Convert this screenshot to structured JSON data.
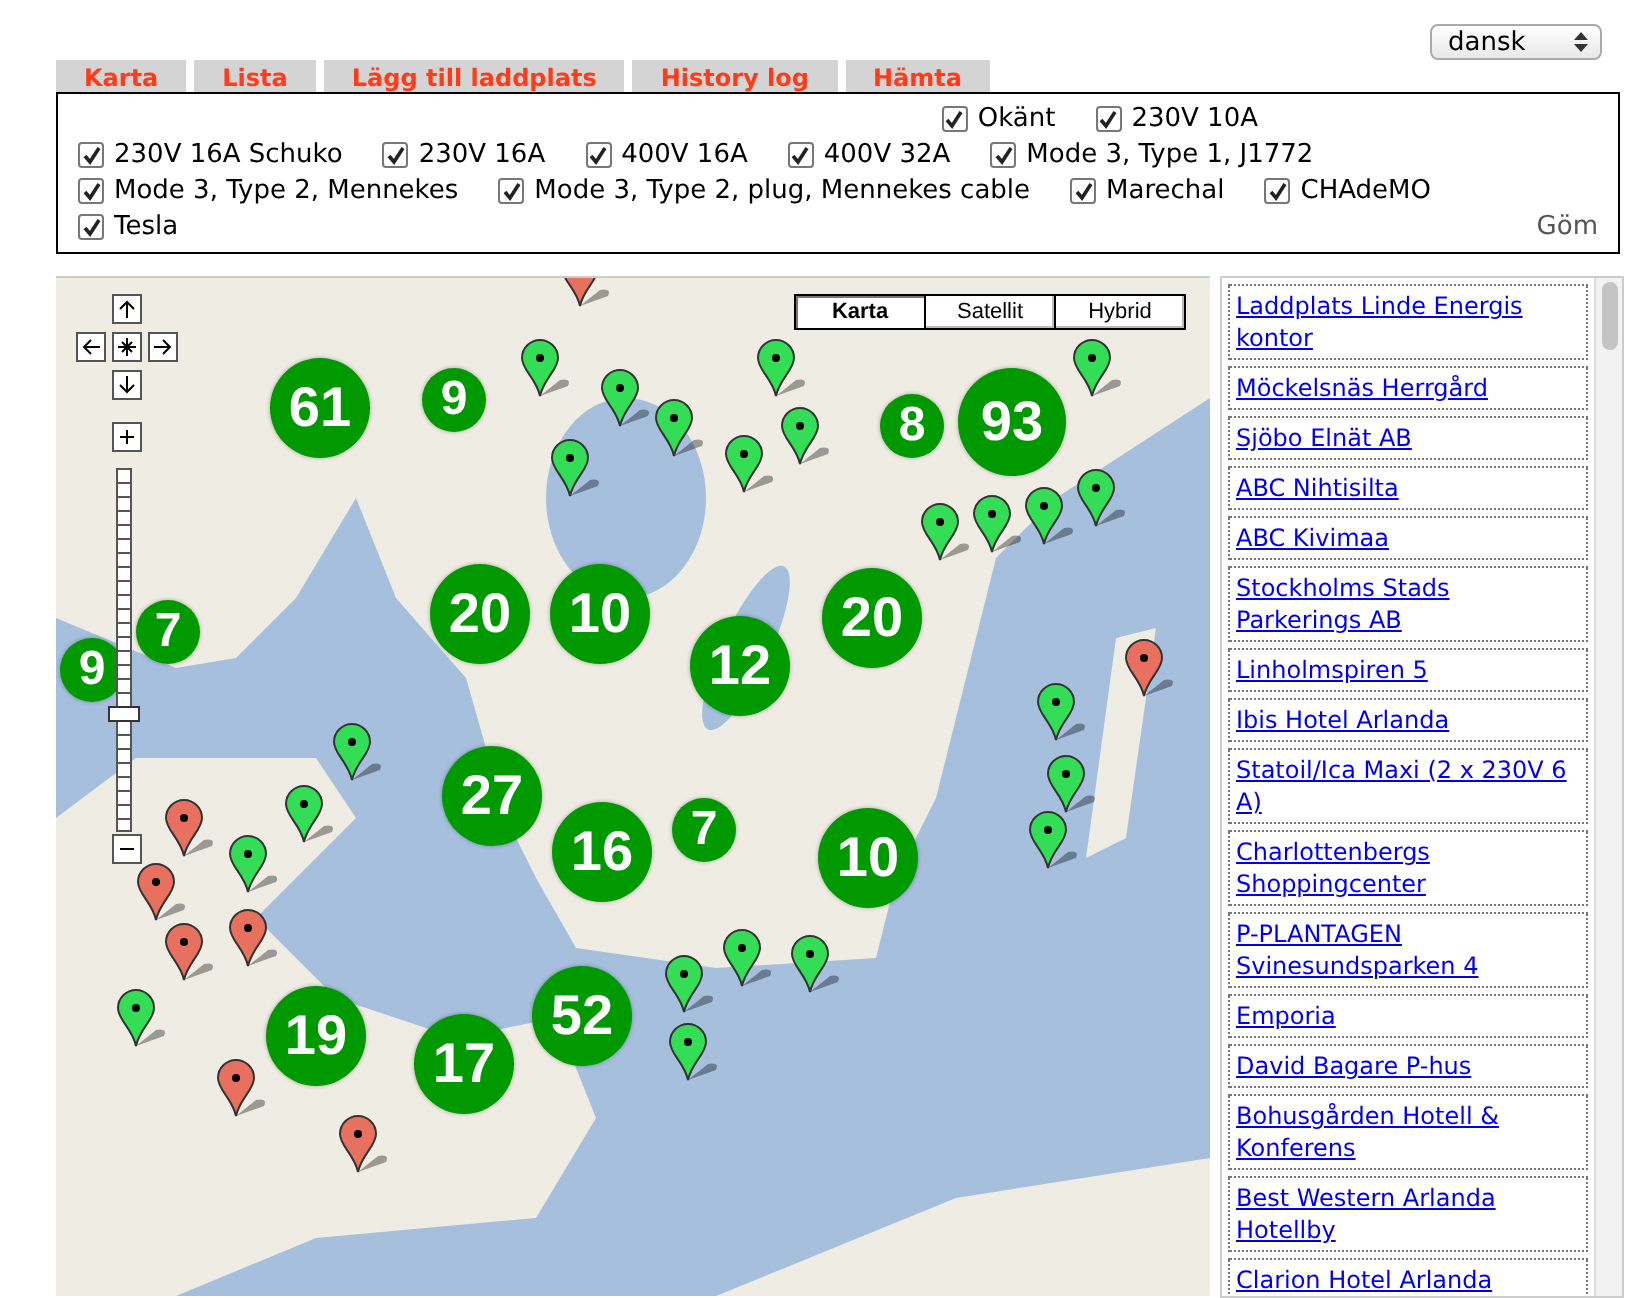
{
  "language_select": {
    "value": "dansk"
  },
  "tabs": [
    {
      "label": "Karta"
    },
    {
      "label": "Lista"
    },
    {
      "label": "Lägg till laddplats"
    },
    {
      "label": "History log"
    },
    {
      "label": "Hämta"
    }
  ],
  "filters": [
    {
      "label": "Okänt",
      "checked": true
    },
    {
      "label": "230V 10A",
      "checked": true
    },
    {
      "label": "230V 16A Schuko",
      "checked": true
    },
    {
      "label": "230V 16A",
      "checked": true
    },
    {
      "label": "400V 16A",
      "checked": true
    },
    {
      "label": "400V 32A",
      "checked": true
    },
    {
      "label": "Mode 3, Type 1, J1772",
      "checked": true
    },
    {
      "label": "Mode 3, Type 2, Mennekes",
      "checked": true
    },
    {
      "label": "Mode 3, Type 2, plug, Mennekes cable",
      "checked": true
    },
    {
      "label": "Marechal",
      "checked": true
    },
    {
      "label": "CHAdeMO",
      "checked": true
    },
    {
      "label": "Tesla",
      "checked": true
    }
  ],
  "hide_link": "Göm",
  "map": {
    "map_types": [
      {
        "label": "Karta",
        "selected": true
      },
      {
        "label": "Satellit",
        "selected": false
      },
      {
        "label": "Hybrid",
        "selected": false
      }
    ],
    "zoom": {
      "level": 0.32
    },
    "clusters": [
      "61",
      "9",
      "8",
      "93",
      "9",
      "7",
      "20",
      "10",
      "12",
      "20",
      "27",
      "16",
      "7",
      "10",
      "19",
      "17",
      "52"
    ],
    "markers": [
      {
        "color": "#e8705f"
      },
      {
        "color": "#33dd55"
      },
      {
        "color": "#33dd55"
      },
      {
        "color": "#33dd55"
      },
      {
        "color": "#33dd55"
      },
      {
        "color": "#33dd55"
      },
      {
        "color": "#33dd55"
      },
      {
        "color": "#33dd55"
      },
      {
        "color": "#33dd55"
      },
      {
        "color": "#33dd55"
      },
      {
        "color": "#33dd55"
      },
      {
        "color": "#33dd55"
      },
      {
        "color": "#33dd55"
      },
      {
        "color": "#e8705f"
      },
      {
        "color": "#33dd55"
      },
      {
        "color": "#33dd55"
      },
      {
        "color": "#33dd55"
      },
      {
        "color": "#33dd55"
      },
      {
        "color": "#e8705f"
      },
      {
        "color": "#33dd55"
      },
      {
        "color": "#33dd55"
      },
      {
        "color": "#e8705f"
      },
      {
        "color": "#e8705f"
      },
      {
        "color": "#e8705f"
      },
      {
        "color": "#33dd55"
      },
      {
        "color": "#33dd55"
      },
      {
        "color": "#33dd55"
      },
      {
        "color": "#33dd55"
      },
      {
        "color": "#33dd55"
      },
      {
        "color": "#e8705f"
      },
      {
        "color": "#e8705f"
      }
    ]
  },
  "locations": [
    "Laddplats Linde Energis kontor",
    "Möckelsnäs Herrgård",
    "Sjöbo Elnät AB",
    "ABC Nihtisilta",
    "ABC Kivimaa",
    "Stockholms Stads Parkerings AB",
    "Linholmspiren 5",
    "Ibis Hotel Arlanda",
    "Statoil/Ica Maxi (2 x 230V 6 A)",
    "Charlottenbergs Shoppingcenter",
    "P-PLANTAGEN Svinesundsparken 4",
    "Emporia",
    "David Bagare P-hus",
    "Bohusgården Hotell & Konferens",
    "Best Western Arlanda Hotellby",
    "Clarion Hotel Arlanda"
  ]
}
